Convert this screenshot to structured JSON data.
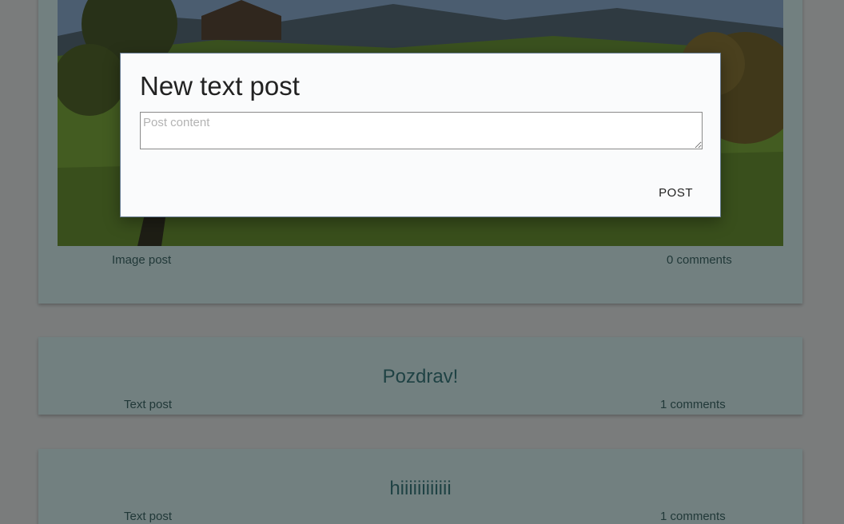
{
  "feed": {
    "image_post": {
      "type_label": "Image post",
      "comments_label": "0 comments"
    },
    "text_post_1": {
      "title": "Pozdrav!",
      "type_label": "Text post",
      "comments_label": "1 comments"
    },
    "text_post_2": {
      "title": "hiiiiiiiiiiii",
      "type_label": "Text post",
      "comments_label": "1 comments"
    }
  },
  "dialog": {
    "title": "New text post",
    "input_placeholder": "Post content",
    "input_value": "",
    "post_button_label": "POST"
  },
  "colors": {
    "card_background": "#d7f2f2",
    "title_text": "#3c7d80",
    "overlay": "rgba(0,0,0,0.47)"
  }
}
